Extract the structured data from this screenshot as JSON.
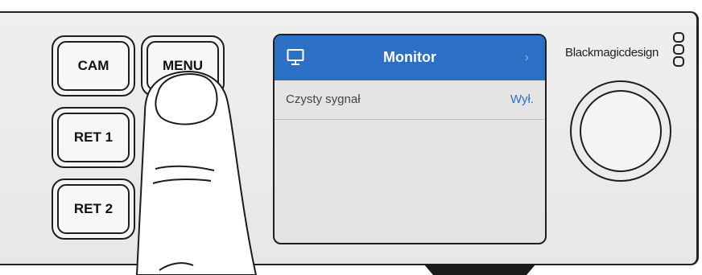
{
  "buttons": {
    "cam": "CAM",
    "menu": "MENU",
    "ret1": "RET 1",
    "ret2": "RET 2"
  },
  "lcd": {
    "title": "Monitor",
    "header_icon": "monitor-icon",
    "chevron": "›",
    "rows": [
      {
        "label": "Czysty sygnał",
        "value": "Wył."
      }
    ]
  },
  "brand": {
    "name": "Blackmagicdesign"
  },
  "colors": {
    "header_blue": "#2c70c5",
    "value_blue": "#2c70c5",
    "panel": "#ebebeb"
  }
}
